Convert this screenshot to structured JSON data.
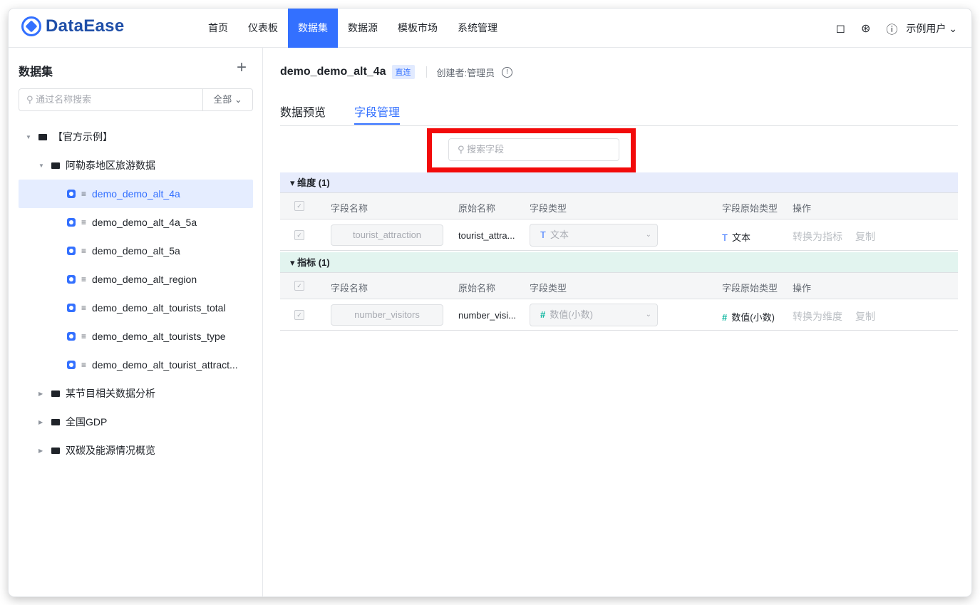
{
  "header": {
    "logo_text": "DataEase",
    "nav": [
      "首页",
      "仪表板",
      "数据集",
      "数据源",
      "模板市场",
      "系统管理"
    ],
    "active_nav_index": 2,
    "user": "示例用户"
  },
  "sidebar": {
    "title": "数据集",
    "plus": "+",
    "search_placeholder": "通过名称搜索",
    "filter": "全部",
    "tree": [
      {
        "label": "【官方示例】",
        "level": 0,
        "type": "folder",
        "expanded": true
      },
      {
        "label": "阿勒泰地区旅游数据",
        "level": 1,
        "type": "folder",
        "expanded": true
      },
      {
        "label": "demo_demo_alt_4a",
        "level": 2,
        "type": "dataset",
        "active": true
      },
      {
        "label": "demo_demo_alt_4a_5a",
        "level": 2,
        "type": "dataset"
      },
      {
        "label": "demo_demo_alt_5a",
        "level": 2,
        "type": "dataset"
      },
      {
        "label": "demo_demo_alt_region",
        "level": 2,
        "type": "dataset"
      },
      {
        "label": "demo_demo_alt_tourists_total",
        "level": 2,
        "type": "dataset"
      },
      {
        "label": "demo_demo_alt_tourists_type",
        "level": 2,
        "type": "dataset"
      },
      {
        "label": "demo_demo_alt_tourist_attract...",
        "level": 2,
        "type": "dataset"
      },
      {
        "label": "某节目相关数据分析",
        "level": 1,
        "type": "folder",
        "expanded": false
      },
      {
        "label": "全国GDP",
        "level": 1,
        "type": "folder",
        "expanded": false
      },
      {
        "label": "双碳及能源情况概览",
        "level": 1,
        "type": "folder",
        "expanded": false
      }
    ]
  },
  "main": {
    "dataset_name": "demo_demo_alt_4a",
    "badge": "直连",
    "creator": "创建者:管理员",
    "tabs": [
      "数据预览",
      "字段管理"
    ],
    "field_search_placeholder": "搜索字段",
    "columns": [
      "字段名称",
      "原始名称",
      "字段类型",
      "字段原始类型",
      "操作"
    ],
    "dimension": {
      "title": "维度 (1)",
      "row": {
        "field": "tourist_attraction",
        "origin": "tourist_attra...",
        "type_icon": "T",
        "type": "文本",
        "orig_icon": "T",
        "orig_type": "文本",
        "action1": "转换为指标",
        "action2": "复制"
      }
    },
    "indicator": {
      "title": "指标 (1)",
      "row": {
        "field": "number_visitors",
        "origin": "number_visi...",
        "type_icon": "#",
        "type": "数值(小数)",
        "orig_icon": "#",
        "orig_type": "数值(小数)",
        "action1": "转换为维度",
        "action2": "复制"
      }
    }
  },
  "colors": {
    "accent": "#3370ff",
    "highlight": "#f20a0a",
    "dimension_bg": "#e7ecfc",
    "indicator_bg": "#e2f4ef"
  }
}
